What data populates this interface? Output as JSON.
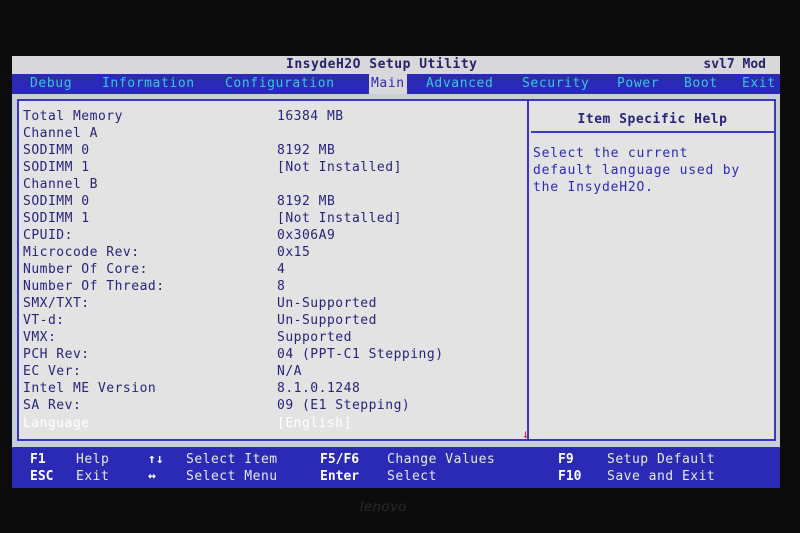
{
  "titlebar": {
    "title": "InsydeH2O Setup Utility",
    "model": "svl7 Mod"
  },
  "menu": {
    "items": [
      {
        "label": "Debug"
      },
      {
        "label": "Information"
      },
      {
        "label": "Configuration"
      },
      {
        "label": "Main",
        "active": true
      },
      {
        "label": "Advanced"
      },
      {
        "label": "Security"
      },
      {
        "label": "Power"
      },
      {
        "label": "Boot"
      },
      {
        "label": "Exit"
      }
    ]
  },
  "main": {
    "rows": [
      {
        "label": "Total Memory",
        "value": "16384 MB"
      },
      {
        "label": "Channel A",
        "value": ""
      },
      {
        "label": "SODIMM 0",
        "value": "8192 MB"
      },
      {
        "label": "SODIMM 1",
        "value": "[Not Installed]"
      },
      {
        "label": "Channel B",
        "value": ""
      },
      {
        "label": "SODIMM 0",
        "value": "8192 MB"
      },
      {
        "label": "SODIMM 1",
        "value": "[Not Installed]"
      },
      {
        "label": "CPUID:",
        "value": "0x306A9"
      },
      {
        "label": "Microcode Rev:",
        "value": "0x15"
      },
      {
        "label": "Number Of Core:",
        "value": "4"
      },
      {
        "label": "Number Of Thread:",
        "value": "8"
      },
      {
        "label": "SMX/TXT:",
        "value": "Un-Supported"
      },
      {
        "label": "VT-d:",
        "value": "Un-Supported"
      },
      {
        "label": "VMX:",
        "value": "Supported"
      },
      {
        "label": "PCH Rev:",
        "value": "04 (PPT-C1 Stepping)"
      },
      {
        "label": "EC Ver:",
        "value": "N/A"
      },
      {
        "label": "Intel ME Version",
        "value": "8.1.0.1248"
      },
      {
        "label": "SA Rev:",
        "value": "09 (E1 Stepping)"
      },
      {
        "label": "Language",
        "value": "[English]",
        "selected": true
      }
    ]
  },
  "help": {
    "heading": "Item Specific Help",
    "text_lines": [
      "Select the current",
      "default language used by",
      "the InsydeH2O."
    ]
  },
  "footer": {
    "f1_key": "F1",
    "f1_desc": "Help",
    "esc_key": "ESC",
    "esc_desc": "Exit",
    "updown_key": "↑↓",
    "updown_desc": "Select Item",
    "leftright_key": "↔",
    "leftright_desc": "Select Menu",
    "f5f6_key": "F5/F6",
    "f5f6_desc": "Change Values",
    "enter_key": "Enter",
    "enter_desc": "Select",
    "f9_key": "F9",
    "f9_desc": "Setup Default",
    "f10_key": "F10",
    "f10_desc": "Save and Exit"
  },
  "bezel": {
    "brand": "lenovo"
  },
  "colors": {
    "menu_bg": "#2a2ab6",
    "menu_text": "#39c7dc",
    "panel_bg": "#e3e3e4",
    "text": "#27247a"
  }
}
